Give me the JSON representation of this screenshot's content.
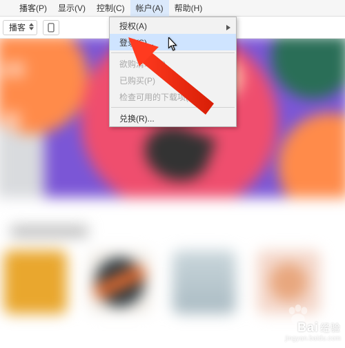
{
  "menubar": {
    "items": [
      "",
      "播客(P)",
      "显示(V)",
      "控制(C)",
      "帐户(A)",
      "帮助(H)"
    ],
    "active_index": 4
  },
  "toolbar": {
    "selector_label": "播客"
  },
  "dropdown": {
    "items": [
      {
        "label": "授权(A)",
        "has_submenu": true,
        "disabled": false,
        "highlight": false
      },
      {
        "label": "登录(S)...",
        "has_submenu": false,
        "disabled": false,
        "highlight": true
      },
      {
        "label": "欲购清单(W)",
        "has_submenu": false,
        "disabled": true,
        "highlight": false
      },
      {
        "label": "已购买(P)",
        "has_submenu": false,
        "disabled": true,
        "highlight": false
      },
      {
        "label": "检查可用的下载项(D)...",
        "has_submenu": false,
        "disabled": true,
        "highlight": false
      },
      {
        "label": "兑换(R)...",
        "has_submenu": false,
        "disabled": false,
        "highlight": false
      }
    ]
  },
  "banner": {
    "year_fragment": "2年",
    "sub_fragment": "节"
  },
  "watermark": {
    "brand": "Bai",
    "brand_suffix": "经验",
    "url": "jingyan.baidu.com"
  }
}
